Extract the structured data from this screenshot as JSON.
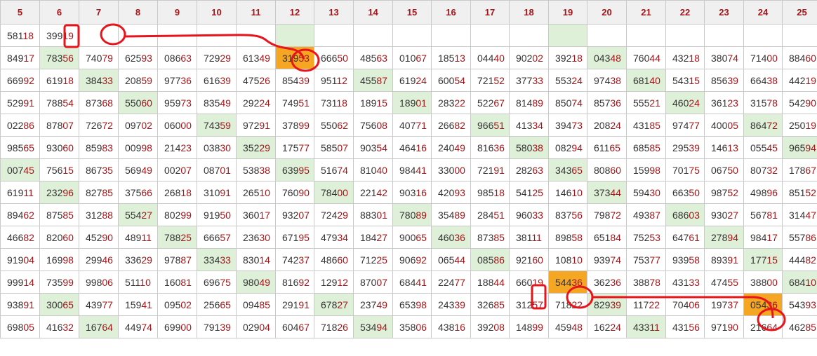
{
  "headers": [
    "5",
    "6",
    "7",
    "8",
    "9",
    "10",
    "11",
    "12",
    "13",
    "14",
    "15",
    "16",
    "17",
    "18",
    "19",
    "20",
    "21",
    "22",
    "23",
    "24",
    "25"
  ],
  "first_row": {
    "cells": [
      "58118",
      "39919",
      "",
      "",
      "",
      "",
      "",
      "",
      "",
      "",
      "",
      "",
      "",
      "",
      "",
      "",
      "",
      "",
      "",
      "",
      ""
    ],
    "highlight": [
      7,
      14
    ]
  },
  "rows": [
    {
      "cells": [
        "84917",
        "78356",
        "74079",
        "62593",
        "08663",
        "72929",
        "61349",
        "31953",
        "66650",
        "48563",
        "01067",
        "18513",
        "04440",
        "90202",
        "39218",
        "04348",
        "76044",
        "43218",
        "38074",
        "71400",
        "88460"
      ],
      "green": [
        1,
        15
      ],
      "orange": [
        7
      ]
    },
    {
      "cells": [
        "66992",
        "61918",
        "38433",
        "20859",
        "97736",
        "61639",
        "47526",
        "85439",
        "95112",
        "45587",
        "61924",
        "60054",
        "72152",
        "37733",
        "55324",
        "97438",
        "68140",
        "54315",
        "85639",
        "66438",
        "44219"
      ],
      "green": [
        2,
        9,
        16
      ]
    },
    {
      "cells": [
        "52991",
        "78854",
        "87368",
        "55060",
        "95973",
        "83549",
        "29224",
        "74951",
        "73118",
        "18915",
        "18901",
        "28322",
        "52267",
        "81489",
        "85074",
        "85736",
        "55521",
        "46024",
        "36123",
        "31578",
        "54290"
      ],
      "green": [
        3,
        10,
        17
      ]
    },
    {
      "cells": [
        "02286",
        "87807",
        "72672",
        "09702",
        "06000",
        "74359",
        "97291",
        "37899",
        "55062",
        "75608",
        "40771",
        "26682",
        "96651",
        "41334",
        "39473",
        "20824",
        "43185",
        "97477",
        "40005",
        "86472",
        "25019"
      ],
      "green": [
        5,
        12,
        19
      ]
    },
    {
      "cells": [
        "98565",
        "93060",
        "85983",
        "00998",
        "21423",
        "03830",
        "35229",
        "17577",
        "58507",
        "90354",
        "46416",
        "24049",
        "81636",
        "58038",
        "08294",
        "61165",
        "68585",
        "29539",
        "14613",
        "05545",
        "96594"
      ],
      "green": [
        6,
        13,
        20
      ]
    },
    {
      "cells": [
        "00745",
        "75615",
        "86735",
        "56949",
        "00207",
        "08701",
        "53838",
        "63995",
        "51674",
        "81040",
        "98441",
        "33000",
        "72191",
        "28263",
        "34365",
        "80860",
        "15998",
        "70175",
        "06750",
        "80732",
        "17867"
      ],
      "green": [
        0,
        7,
        14
      ]
    },
    {
      "cells": [
        "61911",
        "23296",
        "82785",
        "37566",
        "26818",
        "31091",
        "26510",
        "76090",
        "78400",
        "22142",
        "90316",
        "42093",
        "98518",
        "54125",
        "14610",
        "37344",
        "59430",
        "66350",
        "98752",
        "49896",
        "85152"
      ],
      "green": [
        1,
        8,
        15
      ]
    },
    {
      "cells": [
        "89462",
        "87585",
        "31288",
        "55427",
        "80299",
        "91950",
        "36017",
        "93207",
        "72429",
        "88301",
        "78089",
        "35489",
        "28451",
        "96033",
        "83756",
        "79872",
        "49387",
        "68603",
        "93027",
        "56781",
        "31447"
      ],
      "green": [
        3,
        10,
        17
      ]
    },
    {
      "cells": [
        "46682",
        "82060",
        "45290",
        "48911",
        "78825",
        "66657",
        "23630",
        "67195",
        "47934",
        "18427",
        "90065",
        "46036",
        "87385",
        "38111",
        "89858",
        "65184",
        "75253",
        "64761",
        "27894",
        "98417",
        "55786"
      ],
      "green": [
        4,
        11,
        18
      ]
    },
    {
      "cells": [
        "91904",
        "16998",
        "29946",
        "33629",
        "97887",
        "33433",
        "83014",
        "74237",
        "48660",
        "71225",
        "90692",
        "06544",
        "08586",
        "92160",
        "10810",
        "93974",
        "75377",
        "93958",
        "89391",
        "17715",
        "44482"
      ],
      "green": [
        5,
        12,
        19
      ]
    },
    {
      "cells": [
        "99914",
        "73599",
        "99806",
        "51110",
        "16081",
        "69675",
        "98049",
        "81692",
        "12912",
        "87007",
        "68441",
        "22477",
        "18844",
        "66019",
        "54436",
        "36236",
        "38878",
        "43133",
        "47455",
        "38800",
        "68410"
      ],
      "green": [
        6,
        20
      ],
      "orange": [
        14
      ]
    },
    {
      "cells": [
        "93891",
        "30065",
        "43977",
        "15941",
        "09502",
        "25665",
        "09485",
        "29191",
        "67827",
        "23749",
        "65398",
        "24339",
        "32685",
        "31257",
        "71822",
        "82939",
        "11722",
        "70406",
        "19737",
        "05436",
        "54393"
      ],
      "green": [
        1,
        8,
        15
      ],
      "orange": [
        19
      ]
    },
    {
      "cells": [
        "69805",
        "41632",
        "16764",
        "44974",
        "69900",
        "79139",
        "02904",
        "60467",
        "71826",
        "53494",
        "35806",
        "43816",
        "39208",
        "14899",
        "45948",
        "16224",
        "43311",
        "43156",
        "97190",
        "21664",
        "46285"
      ],
      "green": [
        2,
        9,
        16
      ]
    }
  ],
  "colors": {
    "header_text": "#a3161a",
    "tail_digits": "#a3161a",
    "green_cell": "#dff0d8",
    "orange_cell": "#f5a623",
    "annotation_red": "#e8141c"
  }
}
